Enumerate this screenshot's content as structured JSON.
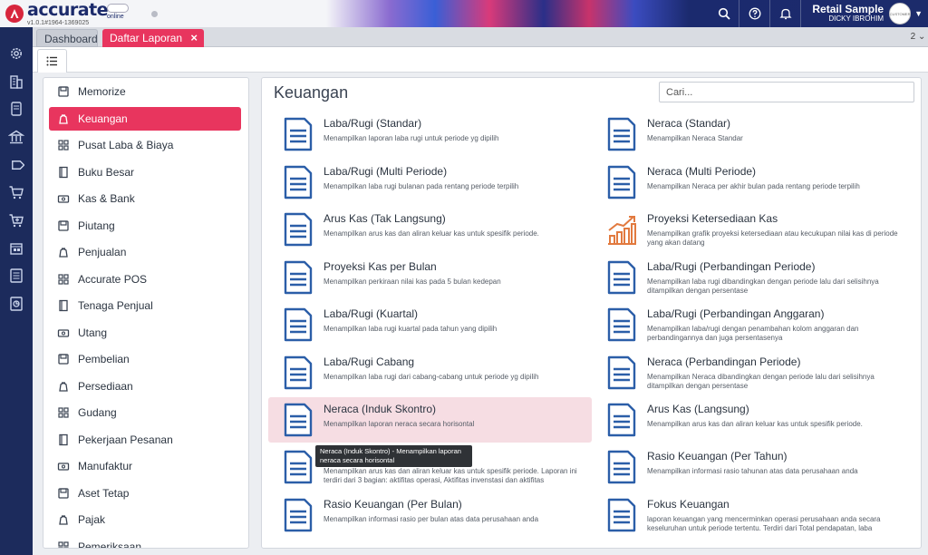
{
  "app": {
    "brand": "accurate",
    "version": "v1.0.1#1964-1369025",
    "online": "online",
    "database": "Retail Sample",
    "user": "DICKY IBROHIM",
    "avatar_text": "CUSTOMER"
  },
  "top_icons": [
    "search-icon",
    "help-icon",
    "bell-icon"
  ],
  "tabs": {
    "dashboard": "Dashboard",
    "reports": "Daftar Laporan",
    "close": "×",
    "counter": "2"
  },
  "rail_icons": [
    "gear-icon",
    "building-icon",
    "phone-icon",
    "bank-icon",
    "tag-icon",
    "cart-icon",
    "cart-plus-icon",
    "warehouse-icon",
    "ledger-icon",
    "chart-icon"
  ],
  "categories": [
    {
      "label": "Memorize",
      "icon": "memorize-icon"
    },
    {
      "label": "Keuangan",
      "icon": "money-bag-icon",
      "active": true
    },
    {
      "label": "Pusat Laba & Biaya",
      "icon": "grid-icon"
    },
    {
      "label": "Buku Besar",
      "icon": "book-icon"
    },
    {
      "label": "Kas & Bank",
      "icon": "cash-icon"
    },
    {
      "label": "Piutang",
      "icon": "receivable-icon"
    },
    {
      "label": "Penjualan",
      "icon": "cart-icon"
    },
    {
      "label": "Accurate POS",
      "icon": "pos-icon"
    },
    {
      "label": "Tenaga Penjual",
      "icon": "salesperson-icon"
    },
    {
      "label": "Utang",
      "icon": "payable-icon"
    },
    {
      "label": "Pembelian",
      "icon": "purchase-icon"
    },
    {
      "label": "Persediaan",
      "icon": "inventory-icon"
    },
    {
      "label": "Gudang",
      "icon": "warehouse-icon"
    },
    {
      "label": "Pekerjaan Pesanan",
      "icon": "job-icon"
    },
    {
      "label": "Manufaktur",
      "icon": "factory-icon"
    },
    {
      "label": "Aset Tetap",
      "icon": "asset-icon"
    },
    {
      "label": "Pajak",
      "icon": "tax-icon"
    },
    {
      "label": "Pemeriksaan",
      "icon": "audit-icon"
    }
  ],
  "reports": {
    "title": "Keuangan",
    "search_placeholder": "Cari...",
    "tooltip": "Neraca (Induk Skontro) - Menampilkan laporan neraca secara horisontal",
    "left": [
      {
        "name": "Laba/Rugi (Standar)",
        "desc": "Menampilkan laporan laba rugi untuk periode yg dipilih",
        "icon": "document-icon"
      },
      {
        "name": "Laba/Rugi (Multi Periode)",
        "desc": "Menampilkan laba rugi bulanan pada rentang periode terpilih",
        "icon": "document-icon"
      },
      {
        "name": "Arus Kas (Tak Langsung)",
        "desc": "Menampilkan arus kas dan aliran keluar kas untuk spesifik periode.",
        "icon": "document-icon"
      },
      {
        "name": "Proyeksi Kas per Bulan",
        "desc": "Menampilkan perkiraan nilai kas pada 5 bulan kedepan",
        "icon": "document-icon"
      },
      {
        "name": "Laba/Rugi (Kuartal)",
        "desc": "Menampilkan laba rugi kuartal pada tahun yang dipilih",
        "icon": "document-icon"
      },
      {
        "name": "Laba/Rugi Cabang",
        "desc": "Menampilkan laba rugi dari cabang-cabang untuk periode yg dipilih",
        "icon": "document-icon"
      },
      {
        "name": "Neraca (Induk Skontro)",
        "desc": "Menampilkan laporan neraca secara horisontal",
        "icon": "document-icon",
        "highlight": true
      },
      {
        "name": "",
        "desc": "Menampilkan arus kas dan aliran keluar kas untuk spesifik periode. Laporan ini terdiri dari 3 bagian: aktifitas operasi, Aktifitas invenstasi dan aktifitas",
        "icon": "document-icon"
      },
      {
        "name": "Rasio Keuangan (Per Bulan)",
        "desc": "Menampilkan informasi rasio per bulan atas data perusahaan anda",
        "icon": "document-icon"
      }
    ],
    "right": [
      {
        "name": "Neraca (Standar)",
        "desc": "Menampilkan Neraca Standar",
        "icon": "document-icon"
      },
      {
        "name": "Neraca (Multi Periode)",
        "desc": "Menampilkan Neraca per akhir bulan pada rentang periode terpilih",
        "icon": "document-icon"
      },
      {
        "name": "Proyeksi Ketersediaan Kas",
        "desc": "Menampilkan grafik proyeksi ketersediaan atau kecukupan nilai kas di periode yang akan datang",
        "icon": "growth-chart-icon"
      },
      {
        "name": "Laba/Rugi (Perbandingan Periode)",
        "desc": "Menampilkan laba rugi dibandingkan dengan periode lalu dari selisihnya ditampilkan dengan persentase",
        "icon": "document-icon"
      },
      {
        "name": "Laba/Rugi (Perbandingan Anggaran)",
        "desc": "Menampilkan laba/rugi dengan penambahan kolom anggaran dan perbandingannya dan juga persentasenya",
        "icon": "document-icon"
      },
      {
        "name": "Neraca (Perbandingan Periode)",
        "desc": "Menampilkan Neraca dibandingkan dengan periode lalu dari selisihnya ditampilkan dengan persentase",
        "icon": "document-icon"
      },
      {
        "name": "Arus Kas (Langsung)",
        "desc": "Menampilkan arus kas dan aliran keluar kas untuk spesifik periode.",
        "icon": "document-icon"
      },
      {
        "name": "Rasio Keuangan (Per Tahun)",
        "desc": "Menampilkan informasi rasio tahunan atas data perusahaan anda",
        "icon": "document-icon"
      },
      {
        "name": "Fokus Keuangan",
        "desc": "laporan keuangan yang mencerminkan operasi perusahaan anda secara keseluruhan untuk periode tertentu. Terdiri dari Total pendapatan, laba",
        "icon": "document-icon"
      }
    ]
  },
  "colors": {
    "accent": "#e8355e",
    "rail": "#1c2b5c",
    "icon_blue": "#2b5ea8",
    "icon_orange": "#e27a3f"
  }
}
